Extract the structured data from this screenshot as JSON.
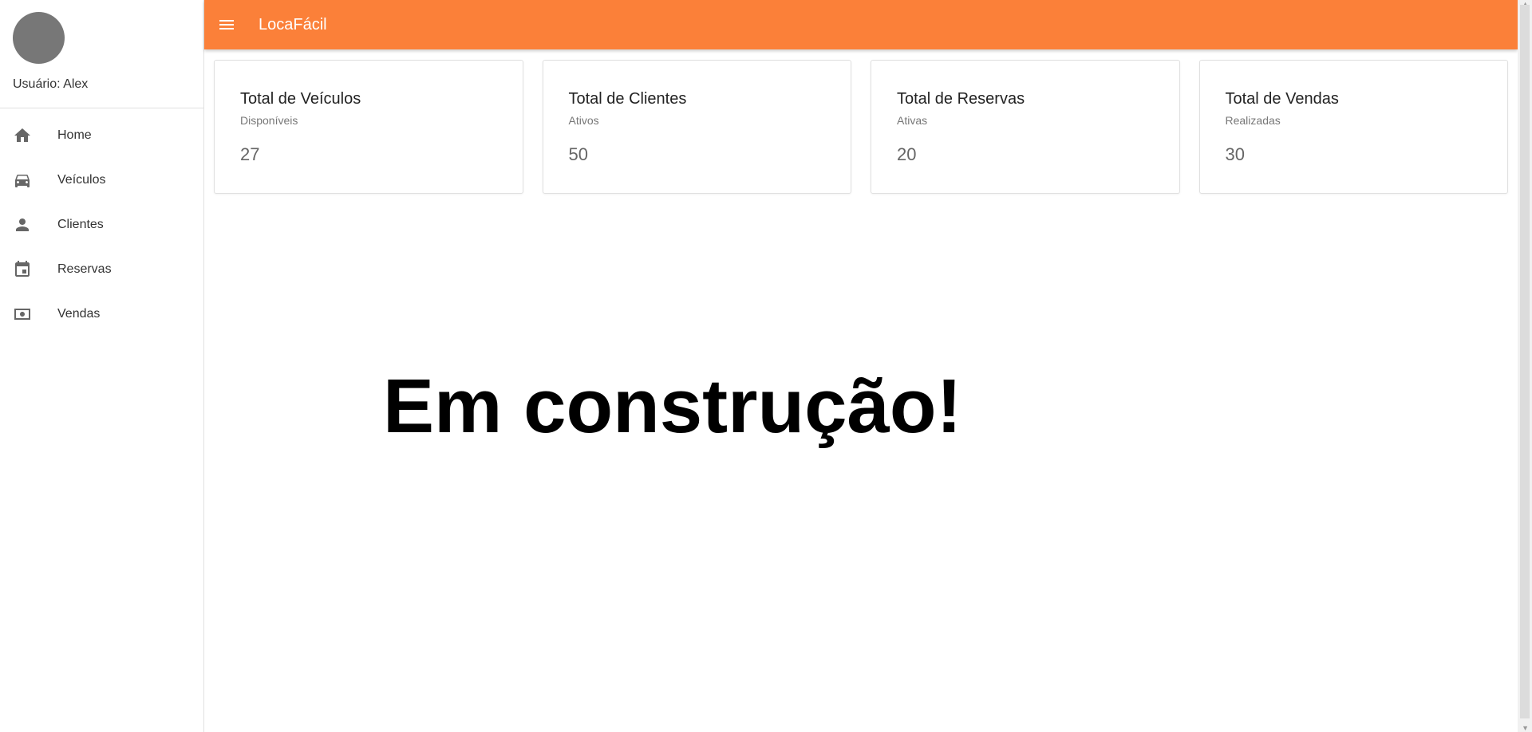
{
  "app": {
    "title": "LocaFácil",
    "accent_color": "#fb8039"
  },
  "user": {
    "label": "Usuário: Alex"
  },
  "sidebar": {
    "items": [
      {
        "label": "Home",
        "icon": "home-icon"
      },
      {
        "label": "Veículos",
        "icon": "car-icon"
      },
      {
        "label": "Clientes",
        "icon": "person-icon"
      },
      {
        "label": "Reservas",
        "icon": "calendar-icon"
      },
      {
        "label": "Vendas",
        "icon": "money-icon"
      }
    ]
  },
  "cards": [
    {
      "title": "Total de Veículos",
      "subtitle": "Disponíveis",
      "value": "27"
    },
    {
      "title": "Total de Clientes",
      "subtitle": "Ativos",
      "value": "50"
    },
    {
      "title": "Total de Reservas",
      "subtitle": "Ativas",
      "value": "20"
    },
    {
      "title": "Total de Vendas",
      "subtitle": "Realizadas",
      "value": "30"
    }
  ],
  "main": {
    "message": "Em construção!"
  }
}
